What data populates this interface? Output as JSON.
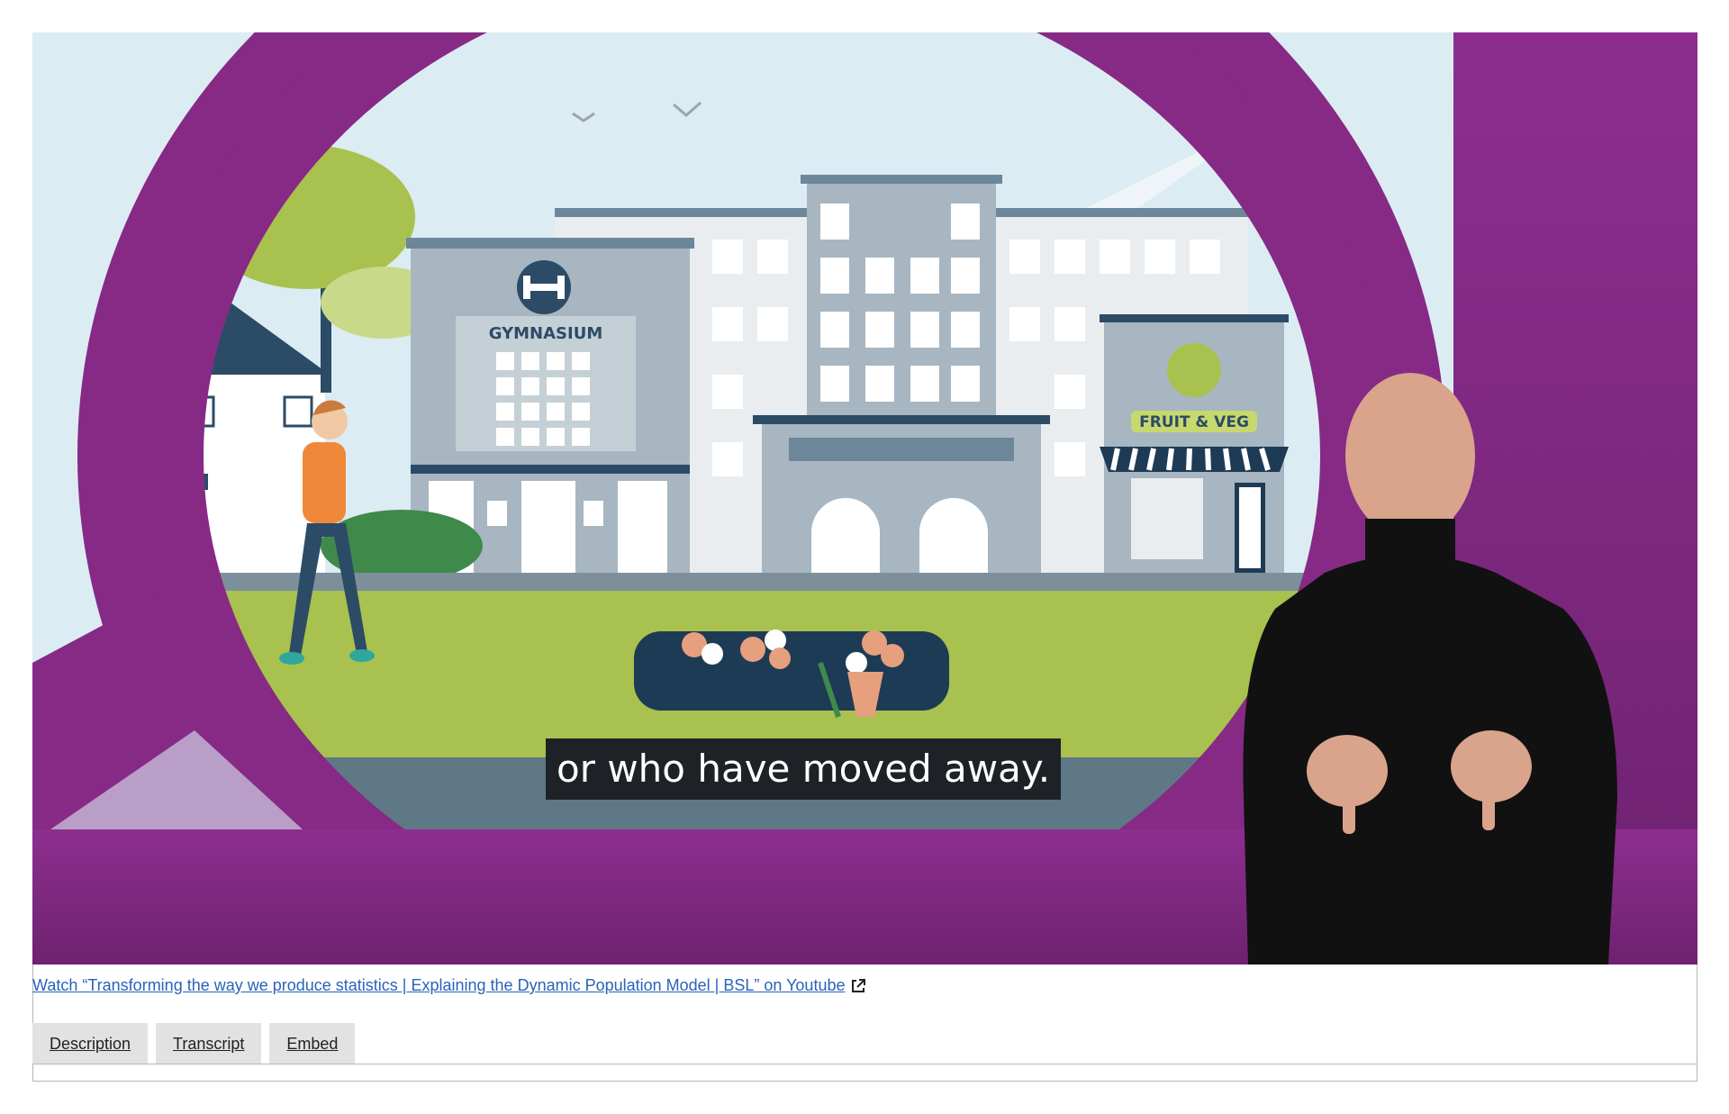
{
  "video": {
    "subtitle": "or who have moved away.",
    "scene_labels": {
      "gym_sign": "GYMNASIUM",
      "shop_sign": "FRUIT & VEG"
    },
    "colors": {
      "frame_purple": "#862a86",
      "sky": "#dcecf3",
      "grass": "#a9c14e"
    }
  },
  "link": {
    "text": "Watch “Transforming the way we produce statistics | Explaining the Dynamic Population Model | BSL” on Youtube",
    "icon": "external-link-icon"
  },
  "tabs": [
    {
      "label": "Description"
    },
    {
      "label": "Transcript"
    },
    {
      "label": "Embed"
    }
  ]
}
